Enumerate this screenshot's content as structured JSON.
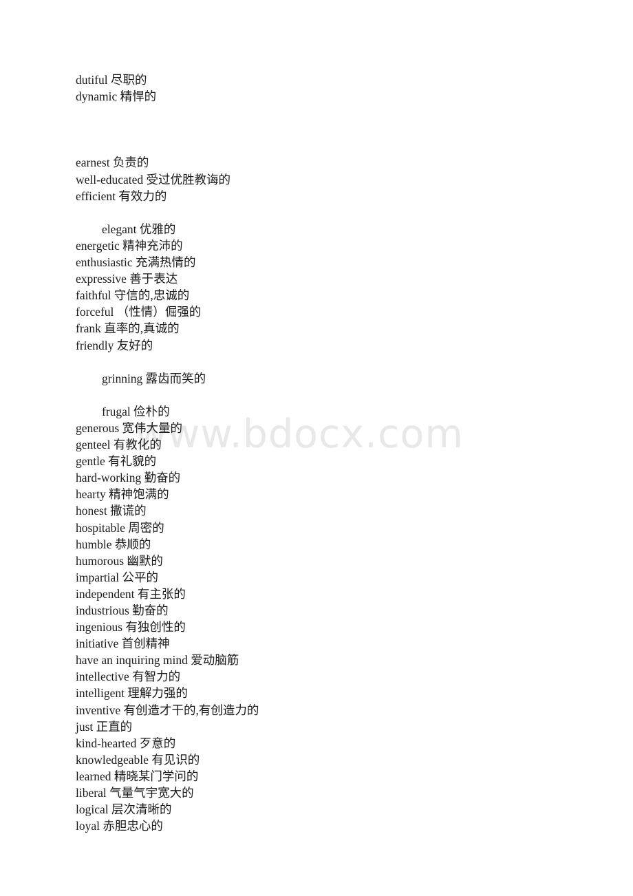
{
  "document": {
    "watermark": "www.bdocx.com",
    "lines": [
      {
        "text": "dutiful 尽职的",
        "indent": false
      },
      {
        "text": "dynamic 精悍的",
        "indent": false
      },
      {
        "text": "",
        "indent": false
      },
      {
        "text": "",
        "indent": false
      },
      {
        "text": "",
        "indent": false
      },
      {
        "text": "earnest 负责的",
        "indent": false
      },
      {
        "text": "well-educated 受过优胜教诲的",
        "indent": false
      },
      {
        "text": "efficient 有效力的",
        "indent": false
      },
      {
        "text": "",
        "indent": false
      },
      {
        "text": "elegant 优雅的",
        "indent": true
      },
      {
        "text": "energetic 精神充沛的",
        "indent": false
      },
      {
        "text": "enthusiastic 充满热情的",
        "indent": false
      },
      {
        "text": "expressive 善于表达",
        "indent": false
      },
      {
        "text": "faithful 守信的,忠诚的",
        "indent": false
      },
      {
        "text": "forceful （性情）倔强的",
        "indent": false
      },
      {
        "text": "frank 直率的,真诚的",
        "indent": false
      },
      {
        "text": "friendly 友好的",
        "indent": false
      },
      {
        "text": "",
        "indent": false
      },
      {
        "text": "grinning 露齿而笑的",
        "indent": true
      },
      {
        "text": "",
        "indent": false
      },
      {
        "text": "frugal 俭朴的",
        "indent": true
      },
      {
        "text": "generous 宽伟大量的",
        "indent": false
      },
      {
        "text": "genteel 有教化的",
        "indent": false
      },
      {
        "text": "gentle 有礼貌的",
        "indent": false
      },
      {
        "text": "hard-working 勤奋的",
        "indent": false
      },
      {
        "text": "hearty 精神饱满的",
        "indent": false
      },
      {
        "text": "honest 撒谎的",
        "indent": false
      },
      {
        "text": "hospitable 周密的",
        "indent": false
      },
      {
        "text": "humble 恭顺的",
        "indent": false
      },
      {
        "text": "humorous 幽默的",
        "indent": false
      },
      {
        "text": "impartial 公平的",
        "indent": false
      },
      {
        "text": "independent 有主张的",
        "indent": false
      },
      {
        "text": "industrious 勤奋的",
        "indent": false
      },
      {
        "text": "ingenious 有独创性的",
        "indent": false
      },
      {
        "text": "initiative 首创精神",
        "indent": false
      },
      {
        "text": "have an inquiring mind 爱动脑筋",
        "indent": false
      },
      {
        "text": "intellective 有智力的",
        "indent": false
      },
      {
        "text": "intelligent 理解力强的",
        "indent": false
      },
      {
        "text": "inventive 有创造才干的,有创造力的",
        "indent": false
      },
      {
        "text": "just 正直的",
        "indent": false
      },
      {
        "text": "kind-hearted 歹意的",
        "indent": false
      },
      {
        "text": "knowledgeable 有见识的",
        "indent": false
      },
      {
        "text": "learned 精晓某门学问的",
        "indent": false
      },
      {
        "text": "liberal 气量气宇宽大的",
        "indent": false
      },
      {
        "text": "logical 层次清晰的",
        "indent": false
      },
      {
        "text": "loyal 赤胆忠心的",
        "indent": false
      }
    ]
  }
}
